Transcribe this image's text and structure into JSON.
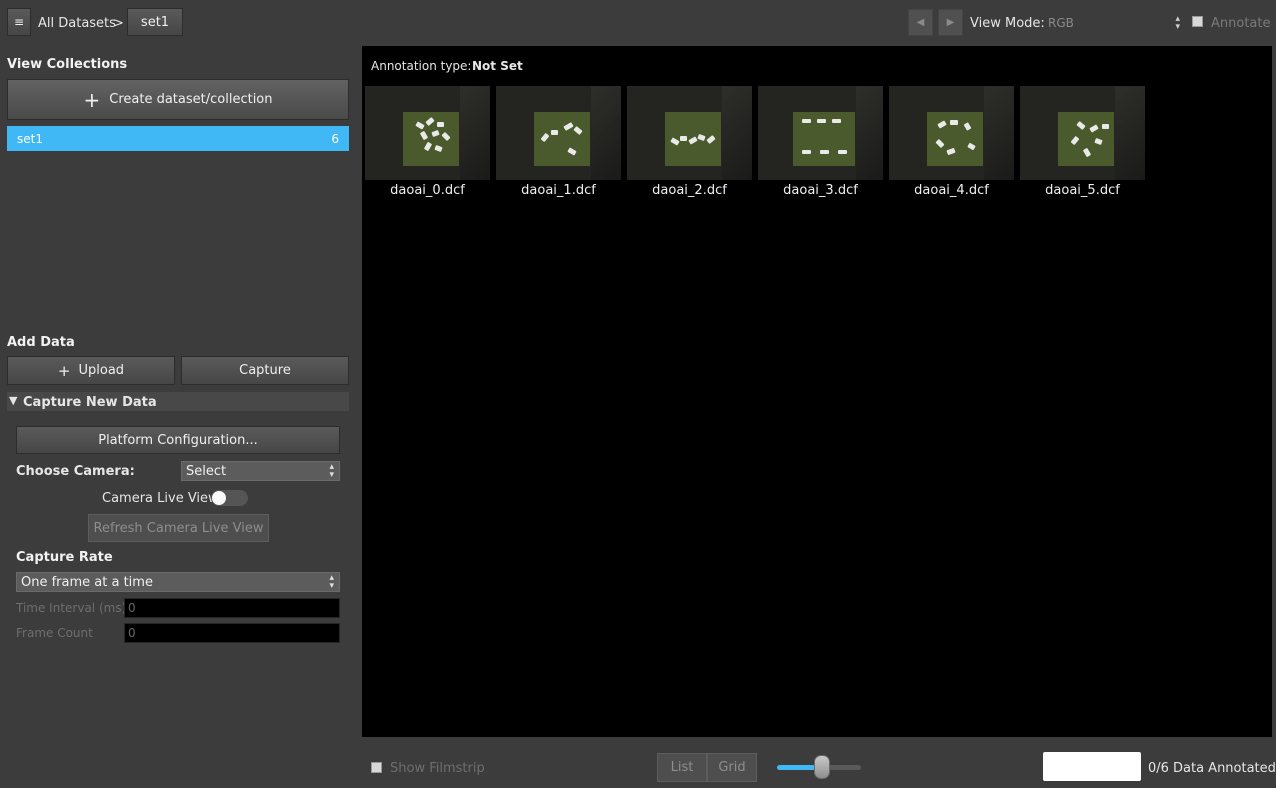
{
  "topbar": {
    "menu_icon": "hamburger-icon",
    "breadcrumb_root": "All Datasets",
    "breadcrumb_sep": ">",
    "breadcrumb_current": "set1",
    "view_mode_label": "View Mode:",
    "view_mode_value": "RGB",
    "annotate_label": "Annotate",
    "prev_icon": "triangle-left-icon",
    "next_icon": "triangle-right-icon"
  },
  "sidebar": {
    "view_collections_title": "View Collections",
    "create_button_label": "Create dataset/collection",
    "collections": [
      {
        "name": "set1",
        "count": "6"
      }
    ],
    "add_data_title": "Add Data",
    "upload_label": "Upload",
    "capture_label": "Capture",
    "capture_new_data_title": "Capture New Data",
    "platform_config_label": "Platform Configuration...",
    "choose_camera_label": "Choose Camera:",
    "camera_select_value": "Select",
    "camera_live_view_label": "Camera Live View",
    "camera_live_view_on": false,
    "refresh_live_view_label": "Refresh Camera Live View",
    "capture_rate_title": "Capture Rate",
    "capture_rate_value": "One frame at a time",
    "time_interval_label": "Time Interval (ms)",
    "time_interval_value": "0",
    "frame_count_label": "Frame Count",
    "frame_count_value": "0"
  },
  "main": {
    "annotation_type_label": "Annotation type:",
    "annotation_type_value": "Not Set",
    "images": [
      {
        "name": "daoai_0.dcf"
      },
      {
        "name": "daoai_1.dcf"
      },
      {
        "name": "daoai_2.dcf"
      },
      {
        "name": "daoai_3.dcf"
      },
      {
        "name": "daoai_4.dcf"
      },
      {
        "name": "daoai_5.dcf"
      }
    ]
  },
  "bottombar": {
    "show_filmstrip_label": "Show Filmstrip",
    "list_label": "List",
    "grid_label": "Grid",
    "zoom_slider_value": 0.55,
    "annotated_count": "0/6",
    "annotated_label": "Data Annotated"
  },
  "colors": {
    "accent": "#3fb8f5",
    "background": "#3c3c3c",
    "viewer_bg": "#000000"
  }
}
